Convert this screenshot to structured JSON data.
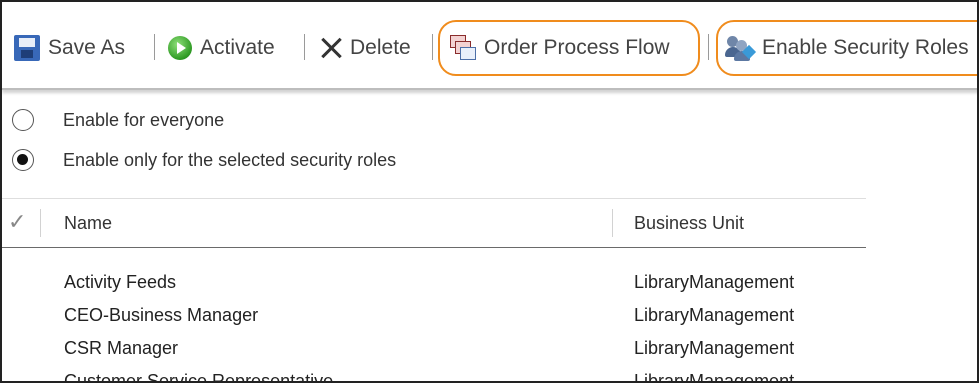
{
  "toolbar": {
    "save_as": {
      "label": "Save As",
      "icon": "save-as-icon"
    },
    "activate": {
      "label": "Activate",
      "icon": "activate-icon"
    },
    "delete": {
      "label": "Delete",
      "icon": "delete-icon"
    },
    "order_process_flow": {
      "label": "Order Process Flow",
      "icon": "order-process-flow-icon"
    },
    "enable_security_roles": {
      "label": "Enable Security Roles",
      "icon": "security-roles-icon"
    },
    "highlight_color": "#f08c1d"
  },
  "options": {
    "everyone": {
      "label": "Enable for everyone",
      "selected": false
    },
    "selected_roles": {
      "label": "Enable only for the selected security roles",
      "selected": true
    }
  },
  "grid": {
    "columns": [
      "Name",
      "Business Unit"
    ],
    "rows": [
      [
        "Activity Feeds",
        "LibraryManagement"
      ],
      [
        "CEO-Business Manager",
        "LibraryManagement"
      ],
      [
        "CSR Manager",
        "LibraryManagement"
      ],
      [
        "Customer Service Representative",
        "LibraryManagement"
      ]
    ]
  }
}
